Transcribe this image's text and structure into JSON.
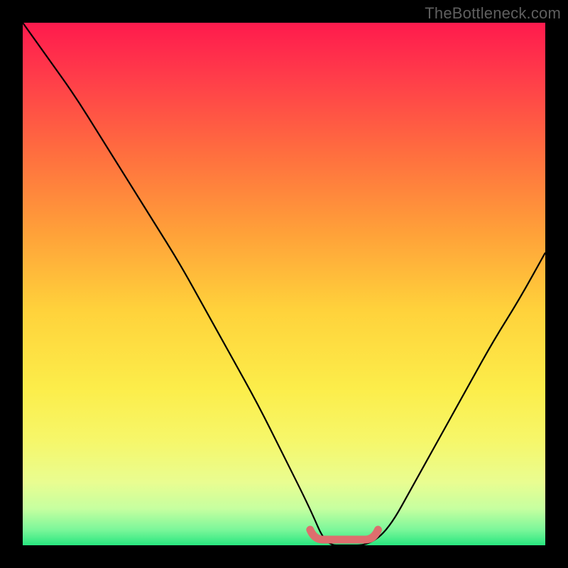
{
  "watermark": "TheBottleneck.com",
  "chart_data": {
    "type": "line",
    "title": "",
    "xlabel": "",
    "ylabel": "",
    "xlim": [
      0,
      1
    ],
    "ylim": [
      0,
      1
    ],
    "series": [
      {
        "name": "bottleneck-curve",
        "x": [
          0.0,
          0.05,
          0.1,
          0.15,
          0.2,
          0.25,
          0.3,
          0.35,
          0.4,
          0.45,
          0.5,
          0.55,
          0.58,
          0.62,
          0.66,
          0.7,
          0.75,
          0.8,
          0.85,
          0.9,
          0.95,
          1.0
        ],
        "y": [
          1.0,
          0.93,
          0.86,
          0.78,
          0.7,
          0.62,
          0.54,
          0.45,
          0.36,
          0.27,
          0.17,
          0.07,
          0.0,
          0.0,
          0.0,
          0.03,
          0.12,
          0.21,
          0.3,
          0.39,
          0.47,
          0.56
        ]
      }
    ],
    "highlight_region": {
      "name": "valley-highlight",
      "x_start": 0.55,
      "x_end": 0.68,
      "y_approx": 0.0
    },
    "background": {
      "type": "vertical-gradient",
      "stops": [
        {
          "pos": 0.0,
          "color": "#ff1a4d"
        },
        {
          "pos": 0.1,
          "color": "#ff3b4a"
        },
        {
          "pos": 0.25,
          "color": "#ff6e3f"
        },
        {
          "pos": 0.4,
          "color": "#ffa039"
        },
        {
          "pos": 0.55,
          "color": "#ffd23b"
        },
        {
          "pos": 0.7,
          "color": "#fced4a"
        },
        {
          "pos": 0.8,
          "color": "#f6f76a"
        },
        {
          "pos": 0.88,
          "color": "#e9fd91"
        },
        {
          "pos": 0.93,
          "color": "#c6ffa0"
        },
        {
          "pos": 0.97,
          "color": "#7cf79a"
        },
        {
          "pos": 1.0,
          "color": "#28e67f"
        }
      ]
    }
  }
}
